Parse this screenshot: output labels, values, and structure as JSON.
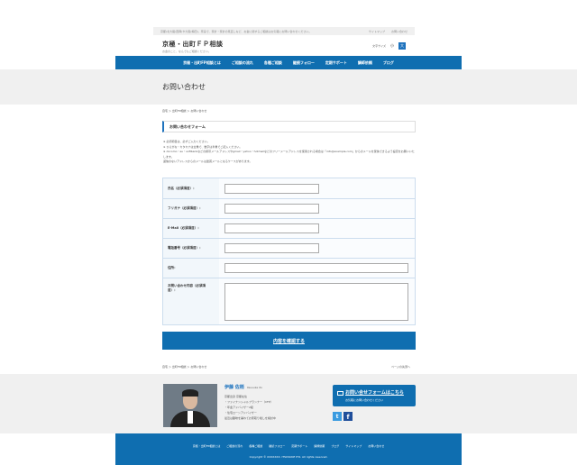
{
  "topbar": {
    "tagline": "京都(北大路/西陣)や大阪(梅田)、奈良で、家計・家計の見直しなど、お金に関するご相談はお気軽にお問い合わせください。",
    "links": [
      "サイトマップ",
      "お問い合わせ"
    ]
  },
  "header": {
    "logo_title": "京極・出町ＦＰ相談",
    "logo_sub": "お金のこと、なんでもご相談ください。",
    "font_label": "文字サイズ",
    "font_small": "小",
    "font_large": "大"
  },
  "nav": {
    "items": [
      "京極・出町FP相談とは",
      "ご相談の流れ",
      "各種ご相談",
      "継続フォロー",
      "定期サポート",
      "講師依頼",
      "ブログ"
    ]
  },
  "page": {
    "title": "お問い合わせ",
    "breadcrumb": "自宅 ＞ 出町FP相談 ＞ お問い合わせ"
  },
  "form": {
    "title": "お問い合わせフォーム",
    "notes": [
      "※ 必須項目は、必ずご入力ください。",
      "※ ひらがな・カタカナは全角で、数字は半角でご記入ください。",
      "※ docomo・au・softbankなどの携帯メールアドレスやgmail・yahoo・hotmailなどのフリーメールアドレスを使用される場合は「info@example.com」からのメールを受信できるよう設定をお願いいたします。",
      "返信のないアドレスからのメールは迷惑メールとなるケースがあります。"
    ],
    "fields": [
      {
        "label": "氏名（必須項目）：",
        "type": "short"
      },
      {
        "label": "フリガナ（必須項目）：",
        "type": "short"
      },
      {
        "label": "E-Mail（必須項目）：",
        "type": "short"
      },
      {
        "label": "電話番号（必須項目）：",
        "type": "short"
      },
      {
        "label": "住所：",
        "type": "long"
      },
      {
        "label": "お問い合わせ内容（必須項目）：",
        "type": "textarea"
      }
    ],
    "submit_label": "内容を確認する"
  },
  "bottom": {
    "breadcrumb": "自宅 ＞ 出町FP相談 ＞ お問い合わせ",
    "pagetop": "ページの先頭へ"
  },
  "profile": {
    "name": "伊藤 佐梢",
    "name_en": "itsusuke ito",
    "desc": [
      "京都出身 京都在住",
      "・ファイナンシャルプランナー（CFP）",
      "・年金アドバイザー2級",
      "・住宅ローンアドバイザー",
      "最近は趣味を兼ねてお家取り壊しを検討中"
    ],
    "contact_l1": "お問い合せフォームはこちら",
    "contact_l2": "お気軽にお問い合わせください",
    "twitter": "t",
    "facebook": "f"
  },
  "footer": {
    "nav": [
      "京極・出町FP相談とは",
      "ご相談の流れ",
      "各種ご相談",
      "継続フォロー",
      "定期サポート",
      "講師依頼",
      "ブログ",
      "サイトマップ",
      "お問い合わせ"
    ],
    "copyright": "Copyright © XXXXXXX. ITSUSUKE ITO. All rights reserved."
  },
  "colors": {
    "primary": "#0f6eb0",
    "band": "#f0f0f0"
  }
}
